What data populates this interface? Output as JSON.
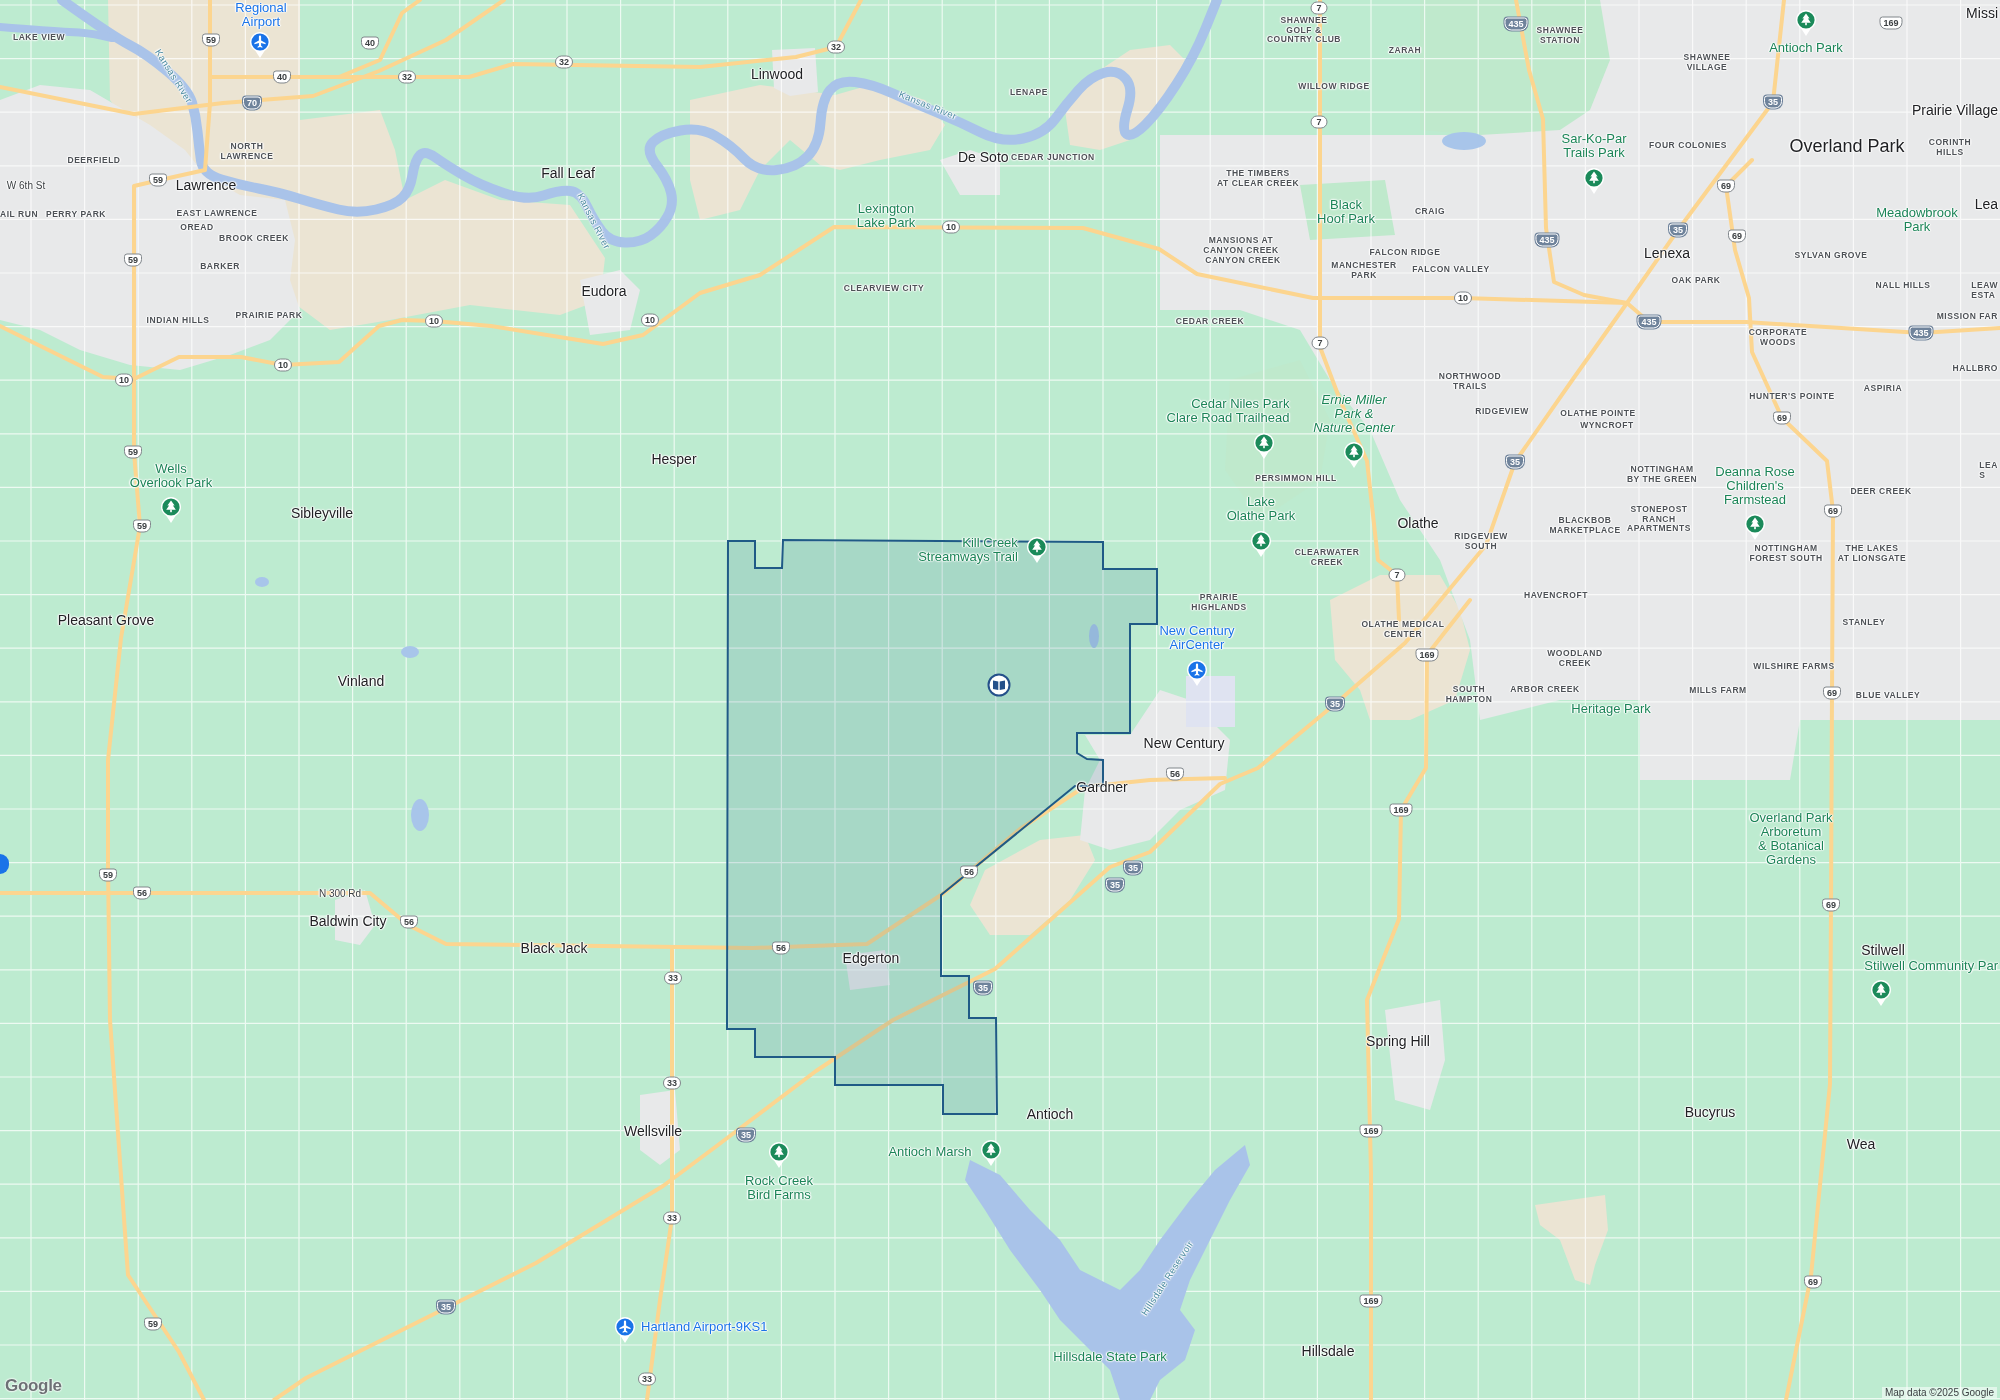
{
  "map": {
    "labels": [
      {
        "kind": "airport",
        "text": "Regional\nAirport"
      },
      {
        "kind": "town",
        "text": "Missi"
      },
      {
        "kind": "district",
        "text": "LAKE VIEW"
      },
      {
        "kind": "district",
        "text": "SHAWNEE\nGOLF &\nCOUNTRY CLUB"
      },
      {
        "kind": "district",
        "text": "SHAWNEE\nSTATION"
      },
      {
        "kind": "water",
        "text": "Kansas River"
      },
      {
        "kind": "district",
        "text": "ZARAH"
      },
      {
        "kind": "district",
        "text": "SHAWNEE\nVILLAGE"
      },
      {
        "kind": "park",
        "text": "Antioch Park"
      },
      {
        "kind": "town",
        "text": "Linwood"
      },
      {
        "kind": "water",
        "text": "Kansas River"
      },
      {
        "kind": "district",
        "text": "LENAPE"
      },
      {
        "kind": "district",
        "text": "WILLOW RIDGE"
      },
      {
        "kind": "town",
        "text": "Prairie Village"
      },
      {
        "kind": "district",
        "text": "DEERFIELD"
      },
      {
        "kind": "district",
        "text": "NORTH\nLAWRENCE"
      },
      {
        "kind": "town",
        "text": "De Soto"
      },
      {
        "kind": "district",
        "text": "CEDAR JUNCTION"
      },
      {
        "kind": "park",
        "text": "Sar-Ko-Par\nTrails Park"
      },
      {
        "kind": "district",
        "text": "FOUR COLONIES"
      },
      {
        "kind": "city",
        "text": "Overland Park"
      },
      {
        "kind": "district",
        "text": "CORINTH HILLS"
      },
      {
        "kind": "road",
        "text": "W 6th St"
      },
      {
        "kind": "town",
        "text": "Lawrence"
      },
      {
        "kind": "town",
        "text": "Fall Leaf"
      },
      {
        "kind": "district",
        "text": "THE TIMBERS\nAT CLEAR CREEK"
      },
      {
        "kind": "district",
        "text": "AIL RUN"
      },
      {
        "kind": "district",
        "text": "PERRY PARK"
      },
      {
        "kind": "district",
        "text": "EAST LAWRENCE"
      },
      {
        "kind": "water",
        "text": "Kansas River"
      },
      {
        "kind": "greenspace",
        "text": "Lexington\nLake Park"
      },
      {
        "kind": "greenspace",
        "text": "Black\nHoof Park"
      },
      {
        "kind": "district",
        "text": "CRAIG"
      },
      {
        "kind": "greenspace",
        "text": "Meadowbrook\nPark"
      },
      {
        "kind": "town",
        "text": "Lea"
      },
      {
        "kind": "district",
        "text": "OREAD"
      },
      {
        "kind": "district",
        "text": "BROOK CREEK"
      },
      {
        "kind": "district",
        "text": "MANSIONS AT\nCANYON CREEK"
      },
      {
        "kind": "district",
        "text": "CANYON CREEK"
      },
      {
        "kind": "district",
        "text": "FALCON RIDGE"
      },
      {
        "kind": "town",
        "text": "Lenexa"
      },
      {
        "kind": "district",
        "text": "SYLVAN GROVE"
      },
      {
        "kind": "district",
        "text": "BARKER"
      },
      {
        "kind": "district",
        "text": "MANCHESTER\nPARK"
      },
      {
        "kind": "district",
        "text": "FALCON VALLEY"
      },
      {
        "kind": "town",
        "text": "Eudora"
      },
      {
        "kind": "district",
        "text": "CLEARVIEW CITY"
      },
      {
        "kind": "district",
        "text": "OAK PARK"
      },
      {
        "kind": "district",
        "text": "NALL HILLS"
      },
      {
        "kind": "district",
        "text": "LEAW\nESTA"
      },
      {
        "kind": "district",
        "text": "INDIAN HILLS"
      },
      {
        "kind": "district",
        "text": "PRAIRIE PARK"
      },
      {
        "kind": "district",
        "text": "CEDAR CREEK"
      },
      {
        "kind": "district",
        "text": "MISSION FAR"
      },
      {
        "kind": "district",
        "text": "CORPORATE\nWOODS"
      },
      {
        "kind": "district",
        "text": "NORTHWOOD\nTRAILS"
      },
      {
        "kind": "district",
        "text": "HALLBRO"
      },
      {
        "kind": "district",
        "text": "HUNTER'S POINTE"
      },
      {
        "kind": "district",
        "text": "ASPIRIA"
      },
      {
        "kind": "park",
        "text": "Cedar Niles Park\nClare Road Trailhead"
      },
      {
        "kind": "park",
        "text": "Ernie Miller\nPark &\nNature Center"
      },
      {
        "kind": "district",
        "text": "RIDGEVIEW"
      },
      {
        "kind": "district",
        "text": "OLATHE POINTE"
      },
      {
        "kind": "district",
        "text": "WYNCROFT"
      },
      {
        "kind": "park",
        "text": "Wells\nOverlook Park"
      },
      {
        "kind": "town",
        "text": "Hesper"
      },
      {
        "kind": "district",
        "text": "PERSIMMON HILL"
      },
      {
        "kind": "district",
        "text": "NOTTINGHAM\nBY THE GREEN"
      },
      {
        "kind": "park",
        "text": "Deanna Rose\nChildren's\nFarmstead"
      },
      {
        "kind": "district",
        "text": "LEA\nS"
      },
      {
        "kind": "district",
        "text": "DEER CREEK"
      },
      {
        "kind": "town",
        "text": "Sibleyville"
      },
      {
        "kind": "park",
        "text": "Lake\nOlathe Park"
      },
      {
        "kind": "town",
        "text": "Olathe"
      },
      {
        "kind": "district",
        "text": "BLACKBOB\nMARKETPLACE"
      },
      {
        "kind": "district",
        "text": "STONEPOST\nRANCH\nAPARTMENTS"
      },
      {
        "kind": "park",
        "text": "Kill Creek\nStreamways Trail"
      },
      {
        "kind": "district",
        "text": "CLEARWATER\nCREEK"
      },
      {
        "kind": "district",
        "text": "RIDGEVIEW\nSOUTH"
      },
      {
        "kind": "district",
        "text": "NOTTINGHAM\nFOREST SOUTH"
      },
      {
        "kind": "district",
        "text": "THE LAKES\nAT LIONSGATE"
      },
      {
        "kind": "district",
        "text": "PRAIRIE\nHIGHLANDS"
      },
      {
        "kind": "district",
        "text": "HAVENCROFT"
      },
      {
        "kind": "town",
        "text": "Pleasant Grove"
      },
      {
        "kind": "airport",
        "text": "New Century\nAirCenter"
      },
      {
        "kind": "district",
        "text": "OLATHE MEDICAL\nCENTER"
      },
      {
        "kind": "district",
        "text": "STANLEY"
      },
      {
        "kind": "district",
        "text": "WOODLAND\nCREEK"
      },
      {
        "kind": "district",
        "text": "WILSHIRE FARMS"
      },
      {
        "kind": "town",
        "text": "Vinland"
      },
      {
        "kind": "district",
        "text": "SOUTH\nHAMPTON"
      },
      {
        "kind": "district",
        "text": "ARBOR CREEK"
      },
      {
        "kind": "district",
        "text": "MILLS FARM"
      },
      {
        "kind": "district",
        "text": "BLUE VALLEY"
      },
      {
        "kind": "greenspace",
        "text": "Heritage Park"
      },
      {
        "kind": "town",
        "text": "New Century"
      },
      {
        "kind": "town",
        "text": "Gardner"
      },
      {
        "kind": "greenspace",
        "text": "Overland Park\nArboretum\n& Botanical\nGardens"
      },
      {
        "kind": "road",
        "text": "N 300 Rd"
      },
      {
        "kind": "town",
        "text": "Baldwin City"
      },
      {
        "kind": "town",
        "text": "Black Jack"
      },
      {
        "kind": "town",
        "text": "Edgerton"
      },
      {
        "kind": "town",
        "text": "Stilwell"
      },
      {
        "kind": "park",
        "text": "Stilwell Community Par"
      },
      {
        "kind": "town",
        "text": "Spring Hill"
      },
      {
        "kind": "town",
        "text": "Antioch"
      },
      {
        "kind": "town",
        "text": "Bucyrus"
      },
      {
        "kind": "town",
        "text": "Wellsville"
      },
      {
        "kind": "park",
        "text": "Antioch Marsh"
      },
      {
        "kind": "town",
        "text": "Wea"
      },
      {
        "kind": "park",
        "text": "Rock Creek\nBird Farms"
      },
      {
        "kind": "airport",
        "text": "Hartland Airport-9KS1"
      },
      {
        "kind": "water",
        "text": "Hillsdale Reservoir"
      },
      {
        "kind": "greenspace",
        "text": "Hillsdale State Park"
      },
      {
        "kind": "town",
        "text": "Hillsdale"
      }
    ],
    "shields": [
      {
        "kind": "state",
        "number": "7"
      },
      {
        "kind": "interstate",
        "number": "435"
      },
      {
        "kind": "us",
        "number": "169"
      },
      {
        "kind": "us",
        "number": "59"
      },
      {
        "kind": "us",
        "number": "40"
      },
      {
        "kind": "state",
        "number": "32"
      },
      {
        "kind": "state",
        "number": "32"
      },
      {
        "kind": "us",
        "number": "40"
      },
      {
        "kind": "state",
        "number": "32"
      },
      {
        "kind": "interstate",
        "number": "70"
      },
      {
        "kind": "interstate",
        "number": "35"
      },
      {
        "kind": "state",
        "number": "7"
      },
      {
        "kind": "us",
        "number": "59"
      },
      {
        "kind": "us",
        "number": "69"
      },
      {
        "kind": "state",
        "number": "10"
      },
      {
        "kind": "interstate",
        "number": "435"
      },
      {
        "kind": "interstate",
        "number": "35"
      },
      {
        "kind": "us",
        "number": "69"
      },
      {
        "kind": "us",
        "number": "59"
      },
      {
        "kind": "state",
        "number": "10"
      },
      {
        "kind": "state",
        "number": "10"
      },
      {
        "kind": "state",
        "number": "10"
      },
      {
        "kind": "interstate",
        "number": "435"
      },
      {
        "kind": "state",
        "number": "7"
      },
      {
        "kind": "interstate",
        "number": "435"
      },
      {
        "kind": "state",
        "number": "10"
      },
      {
        "kind": "state",
        "number": "10"
      },
      {
        "kind": "us",
        "number": "69"
      },
      {
        "kind": "us",
        "number": "59"
      },
      {
        "kind": "interstate",
        "number": "35"
      },
      {
        "kind": "us",
        "number": "69"
      },
      {
        "kind": "us",
        "number": "59"
      },
      {
        "kind": "state",
        "number": "7"
      },
      {
        "kind": "us",
        "number": "169"
      },
      {
        "kind": "interstate",
        "number": "35"
      },
      {
        "kind": "us",
        "number": "69"
      },
      {
        "kind": "us",
        "number": "56"
      },
      {
        "kind": "us",
        "number": "169"
      },
      {
        "kind": "us",
        "number": "59"
      },
      {
        "kind": "us",
        "number": "56"
      },
      {
        "kind": "interstate",
        "number": "35"
      },
      {
        "kind": "us",
        "number": "56"
      },
      {
        "kind": "interstate",
        "number": "35"
      },
      {
        "kind": "us",
        "number": "69"
      },
      {
        "kind": "us",
        "number": "56"
      },
      {
        "kind": "us",
        "number": "56"
      },
      {
        "kind": "state",
        "number": "33"
      },
      {
        "kind": "interstate",
        "number": "35"
      },
      {
        "kind": "state",
        "number": "33"
      },
      {
        "kind": "interstate",
        "number": "35"
      },
      {
        "kind": "us",
        "number": "169"
      },
      {
        "kind": "state",
        "number": "33"
      },
      {
        "kind": "us",
        "number": "69"
      },
      {
        "kind": "interstate",
        "number": "35"
      },
      {
        "kind": "us",
        "number": "169"
      },
      {
        "kind": "us",
        "number": "59"
      },
      {
        "kind": "state",
        "number": "33"
      }
    ],
    "logo": "Google",
    "attribution": "Map data ©2025 Google"
  }
}
